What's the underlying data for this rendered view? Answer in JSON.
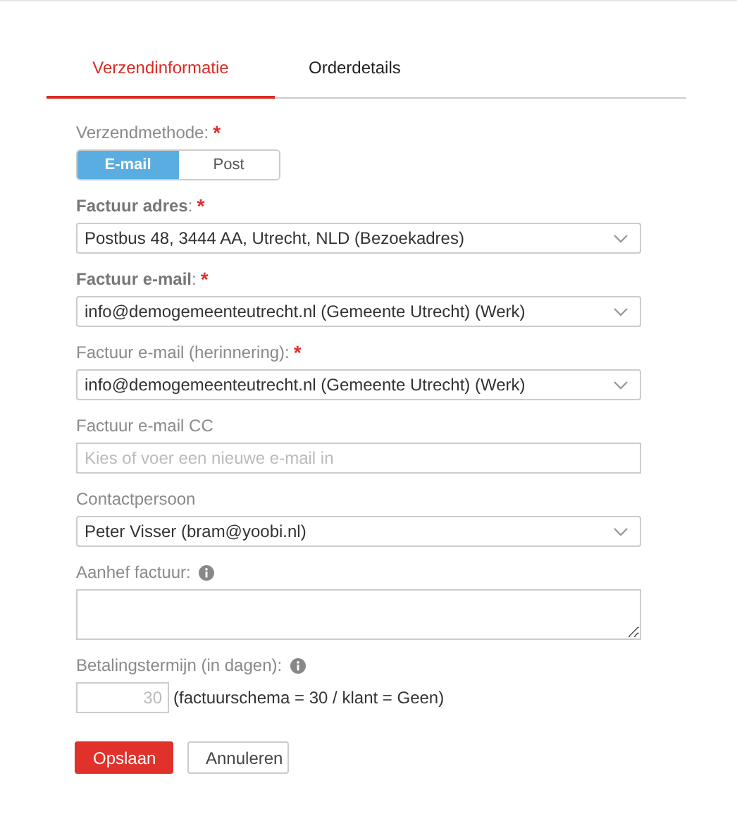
{
  "tabs": [
    {
      "label": "Verzendinformatie",
      "selected": true
    },
    {
      "label": "Orderdetails",
      "selected": false
    }
  ],
  "fields": [
    {
      "kind": "toggle",
      "label": "Verzendmethode:",
      "required_mark": "*",
      "info": false,
      "options": [
        {
          "label": "E-mail",
          "selected": true
        },
        {
          "label": "Post",
          "selected": false
        }
      ]
    },
    {
      "kind": "select",
      "label": "**Factuur adres**:",
      "required_mark": "*",
      "info": false,
      "value": "Postbus 48, 3444 AA, Utrecht, NLD (Bezoekadres)"
    },
    {
      "kind": "select",
      "label": "**Factuur e-mail**:",
      "required_mark": "*",
      "info": false,
      "value": "info@demogemeenteutrecht.nl (Gemeente Utrecht) (Werk)"
    },
    {
      "kind": "select",
      "label": "Factuur e-mail (herinnering):",
      "required_mark": "*",
      "info": false,
      "value": "info@demogemeenteutrecht.nl (Gemeente Utrecht) (Werk)"
    },
    {
      "kind": "input",
      "label": "Factuur e-mail CC",
      "info": false,
      "placeholder": "Kies of voer een nieuwe e-mail in"
    },
    {
      "kind": "select",
      "label": "Contactpersoon",
      "info": false,
      "value": "Peter Visser (bram@yoobi.nl)"
    },
    {
      "kind": "textarea",
      "label": "Aanhef factuur:",
      "info": true
    },
    {
      "kind": "number",
      "label": "Betalingstermijn (in dagen):",
      "info": true,
      "placeholder": "30",
      "note": "(factuurschema = 30 / klant = Geen)"
    }
  ],
  "buttons": [
    {
      "label": "Opslaan",
      "kind": "primary"
    },
    {
      "label": "Annuleren",
      "kind": "secondary"
    }
  ]
}
